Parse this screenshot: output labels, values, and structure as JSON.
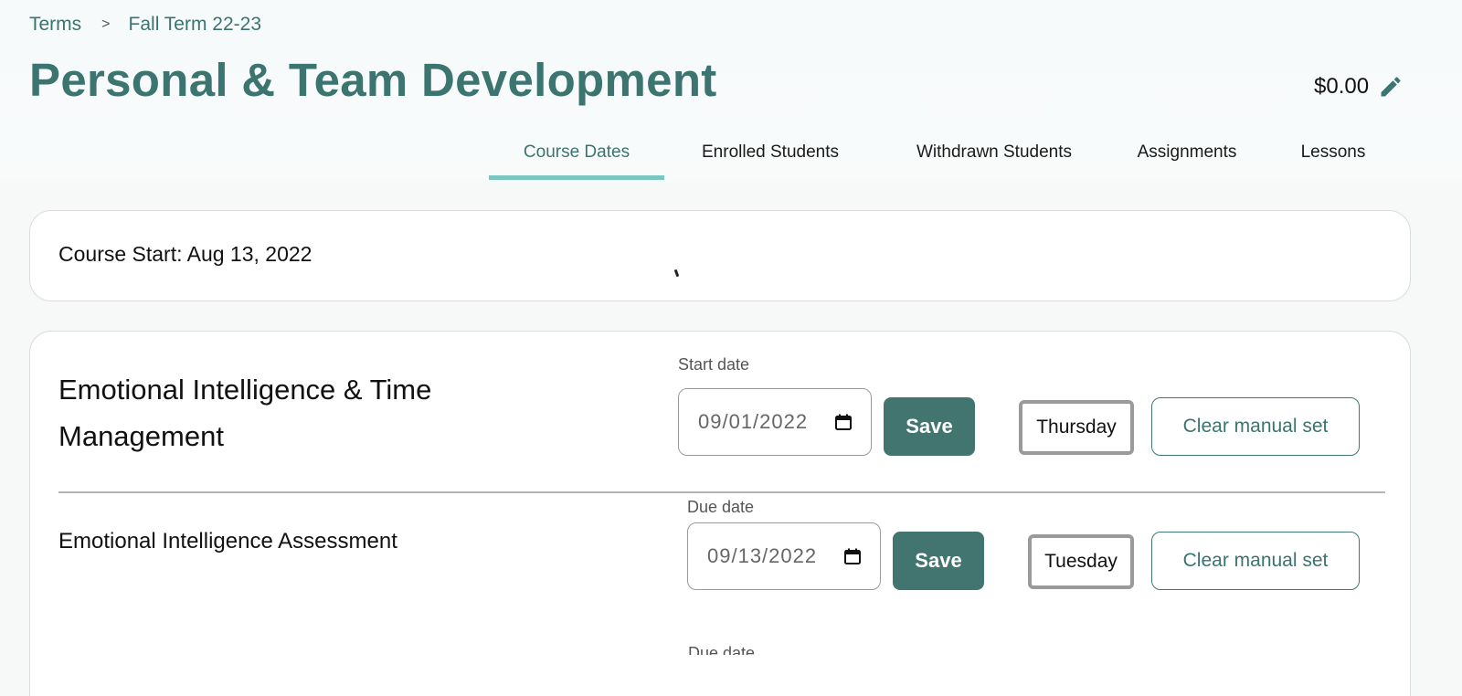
{
  "breadcrumb": {
    "items": [
      "Terms",
      "Fall Term 22-23"
    ],
    "separator": ">"
  },
  "page_title": "Personal & Team Development",
  "price": "$0.00",
  "tabs": [
    {
      "label": "Course Dates",
      "active": true
    },
    {
      "label": "Enrolled Students",
      "active": false
    },
    {
      "label": "Withdrawn Students",
      "active": false
    },
    {
      "label": "Assignments",
      "active": false
    },
    {
      "label": "Lessons",
      "active": false
    }
  ],
  "course_start": "Course Start: Aug 13, 2022",
  "items": [
    {
      "title": "Emotional Intelligence & Time Management",
      "date_label": "Start date",
      "date_value": "09/01/2022",
      "save_label": "Save",
      "day": "Thursday",
      "clear_label": "Clear manual set"
    },
    {
      "title": "Emotional Intelligence Assessment",
      "date_label": "Due date",
      "date_value": "09/13/2022",
      "save_label": "Save",
      "day": "Tuesday",
      "clear_label": "Clear manual set"
    }
  ],
  "partial_label": "Due date",
  "colors": {
    "brand_teal": "#3c7470",
    "button_teal": "#437570",
    "tab_underline": "#7cc6c2"
  }
}
